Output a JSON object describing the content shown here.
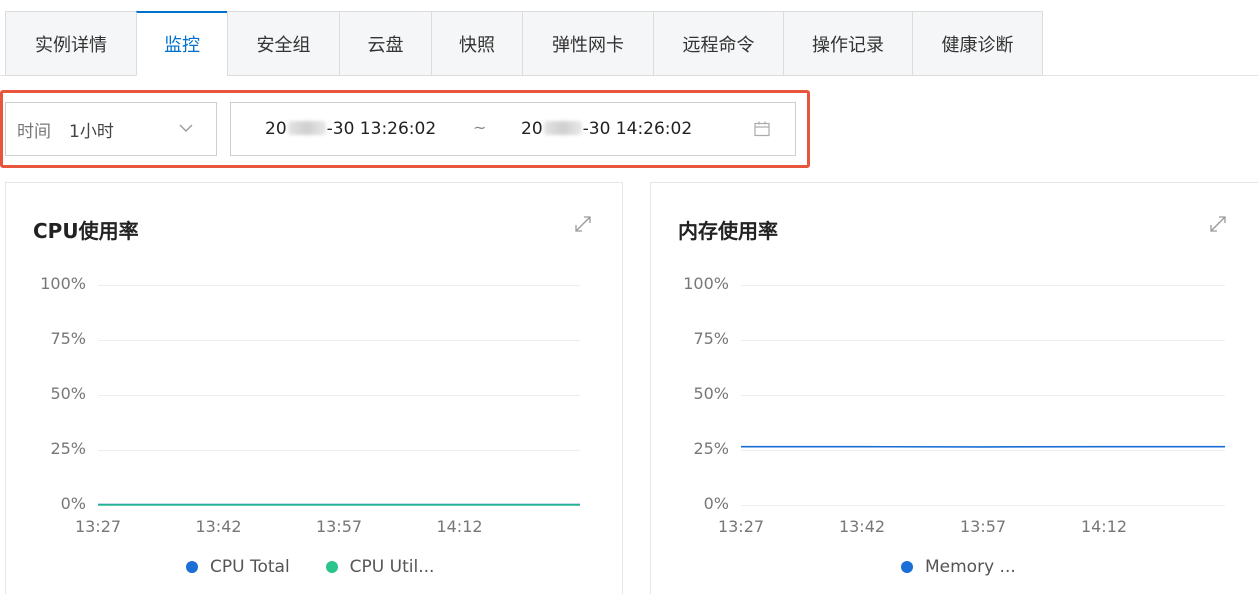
{
  "tabs": [
    {
      "label": "实例详情",
      "active": false
    },
    {
      "label": "监控",
      "active": true
    },
    {
      "label": "安全组",
      "active": false
    },
    {
      "label": "云盘",
      "active": false
    },
    {
      "label": "快照",
      "active": false
    },
    {
      "label": "弹性网卡",
      "active": false
    },
    {
      "label": "远程命令",
      "active": false
    },
    {
      "label": "操作记录",
      "active": false
    },
    {
      "label": "健康诊断",
      "active": false
    }
  ],
  "filter": {
    "time_label": "时间",
    "range_value": "1小时",
    "start_prefix": "20",
    "start_suffix": "-30 13:26:02",
    "separator": "~",
    "end_prefix": "20",
    "end_suffix": "-30 14:26:02"
  },
  "colors": {
    "accent": "#0070cc",
    "highlight": "#e8553d",
    "series_blue": "#1a6ed6",
    "series_green": "#2bc48a"
  },
  "chart_data": [
    {
      "type": "line",
      "title": "CPU使用率",
      "y_ticks": [
        "100%",
        "75%",
        "50%",
        "25%",
        "0%"
      ],
      "ylim": [
        0,
        100
      ],
      "x_ticks": [
        "13:27",
        "13:42",
        "13:57",
        "14:12"
      ],
      "x": [
        "13:27",
        "13:42",
        "13:57",
        "14:12",
        "14:26"
      ],
      "series": [
        {
          "name": "CPU Total",
          "color": "#1a6ed6",
          "values": [
            0.2,
            0.2,
            0.2,
            0.2,
            0.2
          ]
        },
        {
          "name": "CPU Util...",
          "color": "#2bc48a",
          "values": [
            0,
            0,
            0,
            0,
            0
          ]
        }
      ],
      "grid": true,
      "legend": "bottom"
    },
    {
      "type": "line",
      "title": "内存使用率",
      "y_ticks": [
        "100%",
        "75%",
        "50%",
        "25%",
        "0%"
      ],
      "ylim": [
        0,
        100
      ],
      "x_ticks": [
        "13:27",
        "13:42",
        "13:57",
        "14:12"
      ],
      "x": [
        "13:27",
        "13:42",
        "13:57",
        "14:12",
        "14:26"
      ],
      "series": [
        {
          "name": "Memory ...",
          "color": "#1a6ed6",
          "values": [
            26.5,
            26.5,
            26.4,
            26.5,
            26.5
          ]
        }
      ],
      "grid": true,
      "legend": "bottom"
    }
  ]
}
